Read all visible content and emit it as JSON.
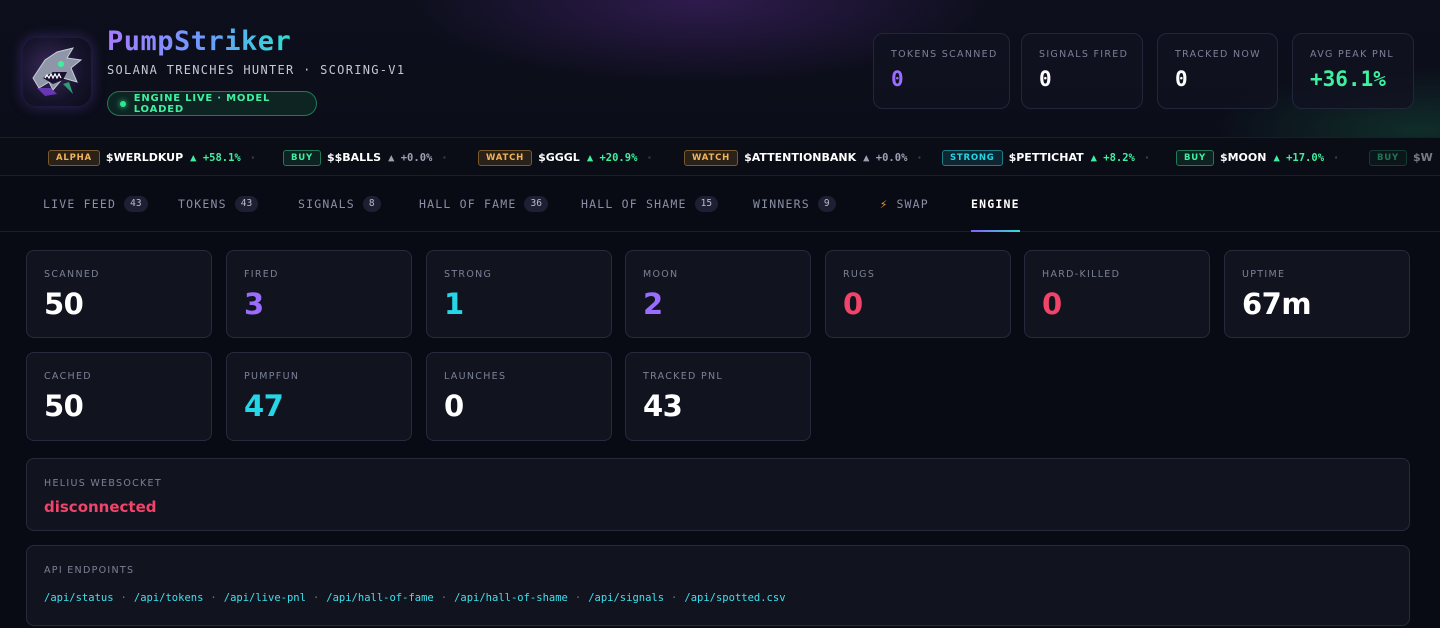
{
  "brand": {
    "title": "PumpStriker",
    "subtitle": "SOLANA TRENCHES HUNTER · SCORING-V1",
    "status": "ENGINE LIVE · MODEL LOADED"
  },
  "header_stats": [
    {
      "label": "TOKENS SCANNED",
      "value": "0"
    },
    {
      "label": "SIGNALS FIRED",
      "value": "0"
    },
    {
      "label": "TRACKED NOW",
      "value": "0"
    },
    {
      "label": "AVG PEAK PNL",
      "value": "+36.1%"
    }
  ],
  "ticker": [
    {
      "badge": "ALPHA",
      "symbol": "$WERLDKUP",
      "change": "▲ +58.1%"
    },
    {
      "badge": "BUY",
      "symbol": "$$BALLS",
      "change": "▲ +0.0%"
    },
    {
      "badge": "WATCH",
      "symbol": "$GGGL",
      "change": "▲ +20.9%"
    },
    {
      "badge": "WATCH",
      "symbol": "$ATTENTIONBANK",
      "change": "▲ +0.0%"
    },
    {
      "badge": "STRONG",
      "symbol": "$PETTICHAT",
      "change": "▲ +8.2%"
    },
    {
      "badge": "BUY",
      "symbol": "$MOON",
      "change": "▲ +17.0%"
    },
    {
      "badge": "BUY",
      "symbol": "$W",
      "change": ""
    }
  ],
  "tabs": [
    {
      "label": "LIVE FEED",
      "count": "43"
    },
    {
      "label": "TOKENS",
      "count": "43"
    },
    {
      "label": "SIGNALS",
      "count": "8"
    },
    {
      "label": "HALL OF FAME",
      "count": "36"
    },
    {
      "label": "HALL OF SHAME",
      "count": "15"
    },
    {
      "label": "WINNERS",
      "count": "9"
    },
    {
      "label": "SWAP",
      "count": ""
    },
    {
      "label": "ENGINE",
      "count": ""
    }
  ],
  "active_tab": "ENGINE",
  "engine_stats": [
    {
      "label": "SCANNED",
      "value": "50"
    },
    {
      "label": "FIRED",
      "value": "3"
    },
    {
      "label": "STRONG",
      "value": "1"
    },
    {
      "label": "MOON",
      "value": "2"
    },
    {
      "label": "RUGS",
      "value": "0"
    },
    {
      "label": "HARD-KILLED",
      "value": "0"
    },
    {
      "label": "UPTIME",
      "value": "67m"
    },
    {
      "label": "CACHED",
      "value": "50"
    },
    {
      "label": "PUMPFUN",
      "value": "47"
    },
    {
      "label": "LAUNCHES",
      "value": "0"
    },
    {
      "label": "TRACKED PNL",
      "value": "43"
    }
  ],
  "helius": {
    "label": "HELIUS WEBSOCKET",
    "status": "disconnected"
  },
  "api": {
    "label": "API ENDPOINTS",
    "endpoints": [
      "/api/status",
      "/api/tokens",
      "/api/live-pnl",
      "/api/hall-of-fame",
      "/api/hall-of-shame",
      "/api/signals",
      "/api/spotted.csv"
    ],
    "separator": "·"
  },
  "colors": {
    "accent_purple": "#9a6cff",
    "accent_cyan": "#25d6e6",
    "accent_green": "#3ff0a0",
    "accent_red": "#f0446a",
    "background": "#090b14"
  },
  "icons": {
    "logo": "shark-logo-icon",
    "swap": "lightning-bolt-icon",
    "status": "status-dot-icon"
  }
}
